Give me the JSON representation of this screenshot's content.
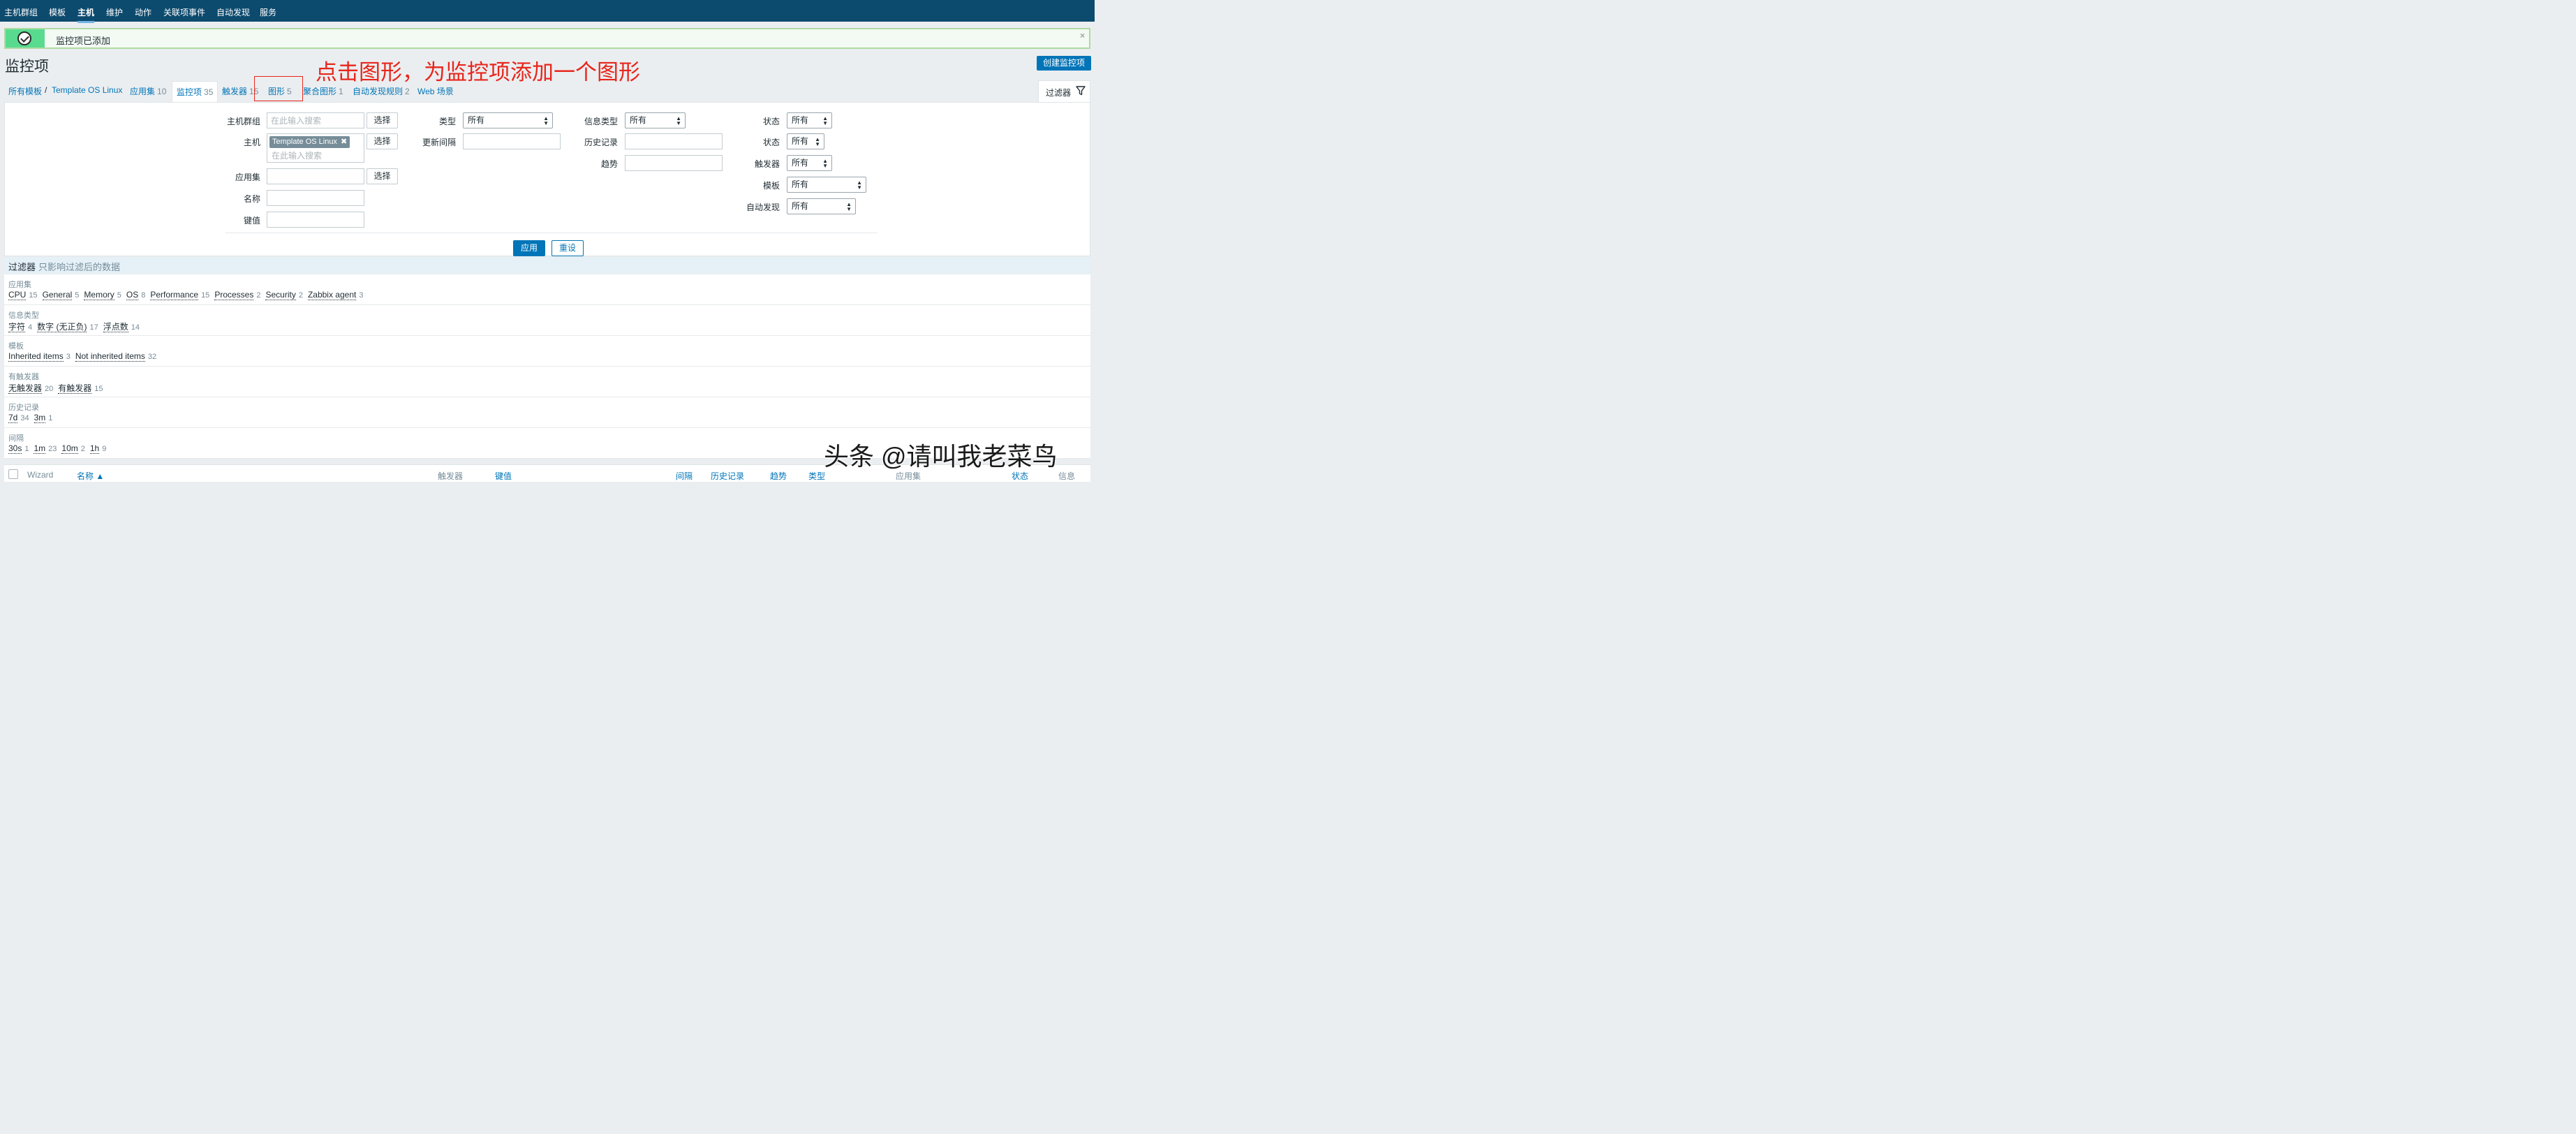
{
  "nav": {
    "items": [
      {
        "label": "主机群组"
      },
      {
        "label": "模板"
      },
      {
        "label": "主机",
        "active": true
      },
      {
        "label": "维护"
      },
      {
        "label": "动作"
      },
      {
        "label": "关联项事件"
      },
      {
        "label": "自动发现"
      },
      {
        "label": "服务"
      }
    ]
  },
  "message": {
    "text": "监控项已添加",
    "close": "×"
  },
  "page": {
    "title": "监控项",
    "create_button": "创建监控项"
  },
  "annotation": "点击图形，为监控项添加一个图形",
  "breadcrumb": {
    "all_templates": "所有模板",
    "separator": "/",
    "template": "Template OS Linux"
  },
  "tabs": [
    {
      "label": "应用集",
      "count": "10"
    },
    {
      "label": "监控项",
      "count": "35",
      "current": true
    },
    {
      "label": "触发器",
      "count": "15"
    },
    {
      "label": "图形",
      "count": "5"
    },
    {
      "label": "聚合图形",
      "count": "1"
    },
    {
      "label": "自动发现规则",
      "count": "2"
    },
    {
      "label": "Web 场景",
      "count": ""
    }
  ],
  "filter_tab": {
    "label": "过滤器"
  },
  "filter": {
    "host_group": {
      "label": "主机群组",
      "placeholder": "在此输入搜索",
      "button": "选择"
    },
    "host": {
      "label": "主机",
      "chip": "Template OS Linux",
      "chip_remove": "✖",
      "placeholder": "在此输入搜索",
      "button": "选择"
    },
    "application": {
      "label": "应用集",
      "button": "选择"
    },
    "name": {
      "label": "名称"
    },
    "key": {
      "label": "键值"
    },
    "type": {
      "label": "类型",
      "value": "所有"
    },
    "update_interval": {
      "label": "更新间隔"
    },
    "info_type": {
      "label": "信息类型",
      "value": "所有"
    },
    "history": {
      "label": "历史记录"
    },
    "trends": {
      "label": "趋势"
    },
    "state": {
      "label": "状态",
      "value": "所有"
    },
    "status": {
      "label": "状态",
      "value": "所有"
    },
    "triggers": {
      "label": "触发器",
      "value": "所有"
    },
    "template": {
      "label": "模板",
      "value": "所有"
    },
    "discovery": {
      "label": "自动发现",
      "value": "所有"
    },
    "apply": "应用",
    "reset": "重设"
  },
  "subfilter": {
    "title": "过滤器",
    "subtitle": "只影响过滤后的数据",
    "sections": [
      {
        "label": "应用集",
        "items": [
          {
            "name": "CPU",
            "count": "15"
          },
          {
            "name": "General",
            "count": "5"
          },
          {
            "name": "Memory",
            "count": "5"
          },
          {
            "name": "OS",
            "count": "8"
          },
          {
            "name": "Performance",
            "count": "15"
          },
          {
            "name": "Processes",
            "count": "2"
          },
          {
            "name": "Security",
            "count": "2"
          },
          {
            "name": "Zabbix agent",
            "count": "3"
          }
        ]
      },
      {
        "label": "信息类型",
        "items": [
          {
            "name": "字符",
            "count": "4"
          },
          {
            "name": "数字 (无正负)",
            "count": "17"
          },
          {
            "name": "浮点数",
            "count": "14"
          }
        ]
      },
      {
        "label": "模板",
        "items": [
          {
            "name": "Inherited items",
            "count": "3"
          },
          {
            "name": "Not inherited items",
            "count": "32"
          }
        ]
      },
      {
        "label": "有触发器",
        "items": [
          {
            "name": "无触发器",
            "count": "20"
          },
          {
            "name": "有触发器",
            "count": "15"
          }
        ]
      },
      {
        "label": "历史记录",
        "items": [
          {
            "name": "7d",
            "count": "34"
          },
          {
            "name": "3m",
            "count": "1"
          }
        ]
      },
      {
        "label": "间隔",
        "items": [
          {
            "name": "30s",
            "count": "1"
          },
          {
            "name": "1m",
            "count": "23"
          },
          {
            "name": "10m",
            "count": "2"
          },
          {
            "name": "1h",
            "count": "9"
          }
        ]
      }
    ]
  },
  "table": {
    "columns": {
      "wizard": "Wizard",
      "name": "名称 ▲",
      "triggers": "触发器",
      "key": "键值",
      "interval": "间隔",
      "history": "历史记录",
      "trends": "趋势",
      "type": "类型",
      "application": "应用集",
      "status": "状态",
      "info": "信息"
    }
  },
  "watermark": "头条 @请叫我老菜鸟"
}
